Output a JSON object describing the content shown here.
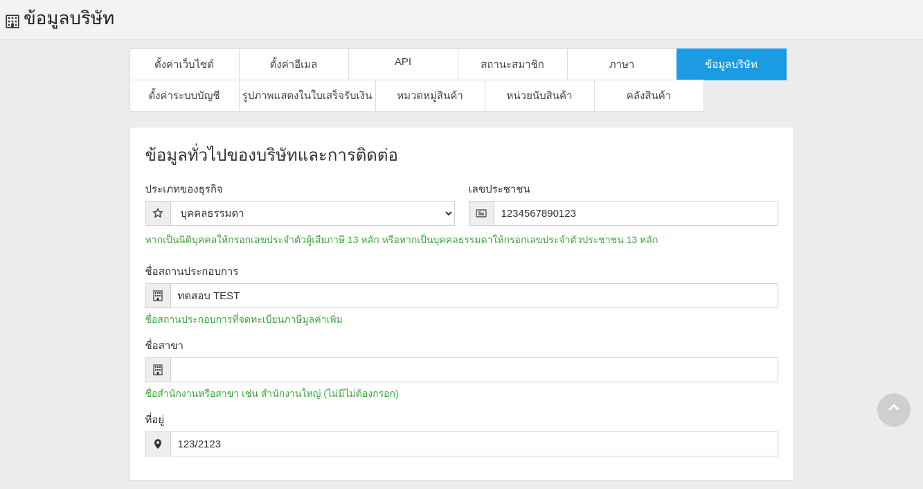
{
  "header": {
    "title": "ข้อมูลบริษัท"
  },
  "tabs": {
    "row1": [
      {
        "label": "ตั้งค่าเว็บไซต์",
        "active": false
      },
      {
        "label": "ตั้งค่าอีเมล",
        "active": false
      },
      {
        "label": "API",
        "active": false
      },
      {
        "label": "สถานะสมาชิก",
        "active": false
      },
      {
        "label": "ภาษา",
        "active": false
      },
      {
        "label": "ข้อมูลบริษัท",
        "active": true
      }
    ],
    "row2": [
      {
        "label": "ตั้งค่าระบบบัญชี",
        "wide": false
      },
      {
        "label": "รูปภาพแสดงในใบเสร็จรับเงิน",
        "wide": true
      },
      {
        "label": "หมวดหมู่สินค้า",
        "wide": false
      },
      {
        "label": "หน่วยนับสินค้า",
        "wide": false
      },
      {
        "label": "คลังสินค้า",
        "wide": false
      }
    ]
  },
  "panel": {
    "title": "ข้อมูลทั่วไปของบริษัทและการติดต่อ",
    "business_type": {
      "label": "ประเภทของธุรกิจ",
      "value": "บุคคลธรรมดา"
    },
    "id_number": {
      "label": "เลขประชาชน",
      "value": "1234567890123"
    },
    "id_help": "หากเป็นนิติบุคคลให้กรอกเลขประจำตัวผู้เสียภาษี 13 หลัก หรือหากเป็นบุคคลธรรมดาให้กรอกเลขประจำตัวประชาชน 13 หลัก",
    "company_name": {
      "label": "ชื่อสถานประกอบการ",
      "value": "ทดสอบ TEST",
      "help": "ชื่อสถานประกอบการที่จดทะเบียนภาษีมูลค่าเพิ่ม"
    },
    "branch_name": {
      "label": "ชื่อสาขา",
      "value": "",
      "help": "ชื่อสำนักงานหรือสาขา เช่น สำนักงานใหญ่ (ไม่มีไม่ต้องกรอก)"
    },
    "address": {
      "label": "ที่อยู่",
      "value": "123/2123"
    }
  }
}
